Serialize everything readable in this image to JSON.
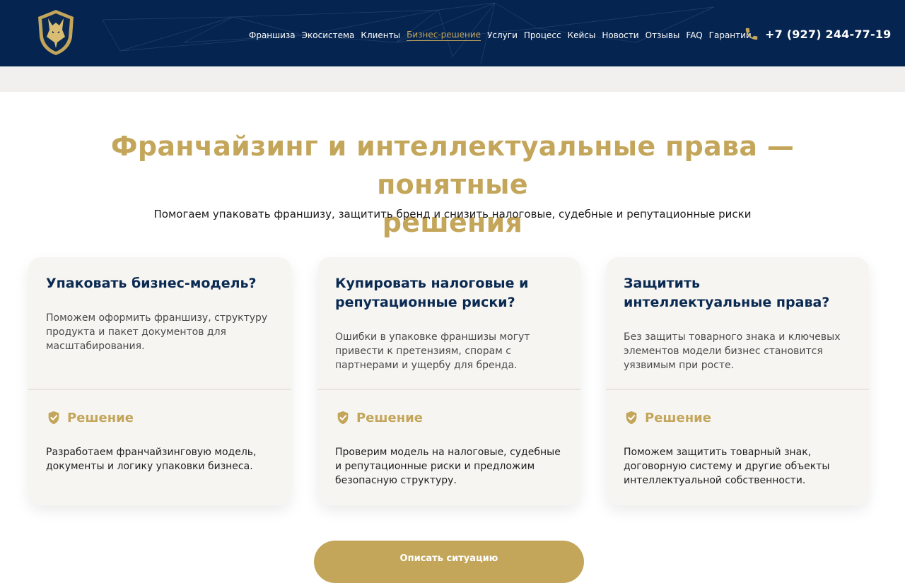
{
  "header": {
    "nav": [
      {
        "label": "Франшиза",
        "active": false
      },
      {
        "label": "Экосистема",
        "active": false
      },
      {
        "label": "Клиенты",
        "active": false
      },
      {
        "label": "Бизнес-решение",
        "active": true
      },
      {
        "label": "Услуги",
        "active": false
      },
      {
        "label": "Процесс",
        "active": false
      },
      {
        "label": "Кейсы",
        "active": false
      },
      {
        "label": "Новости",
        "active": false
      },
      {
        "label": "Отзывы",
        "active": false
      },
      {
        "label": "FAQ",
        "active": false
      },
      {
        "label": "Гарантии",
        "active": false
      }
    ],
    "phone": "+7 (927) 244-77-19",
    "logo_icon": "wolf-shield-logo",
    "phone_icon": "phone-icon"
  },
  "hero": {
    "title_line1": "Франчайзинг и интеллектуальные права — понятные",
    "title_line2": "решения",
    "subtitle": "Помогаем упаковать франшизу, защитить бренд и снизить налоговые, судебные и репутационные риски"
  },
  "cards": [
    {
      "title": "Упаковать бизнес-модель?",
      "description": "Поможем оформить франшизу, структуру продукта и пакет документов для масштабирования.",
      "solution_label": "Решение",
      "solution": "Разработаем франчайзинговую модель, документы и логику упаковки бизнеса."
    },
    {
      "title": "Купировать налоговые и репутационные риски?",
      "description": "Ошибки в упаковке франшизы могут привести к претензиям, спорам с партнерами и ущербу для бренда.",
      "solution_label": "Решение",
      "solution": "Проверим модель на налоговые, судебные и репутационные риски и предложим безопасную структуру."
    },
    {
      "title": "Защитить интеллектуальные права?",
      "description": "Без защиты товарного знака и ключевых элементов модели бизнес становится уязвимым при росте.",
      "solution_label": "Решение",
      "solution": "Поможем защитить товарный знак, договорную систему и другие объекты интеллектуальной собственности."
    }
  ],
  "cta": {
    "label": "Описать ситуацию"
  },
  "colors": {
    "header_bg": "#05244f",
    "accent_gold": "#c4a65b",
    "card_bg": "#f6f5f2",
    "card_title": "#0b2a52"
  }
}
